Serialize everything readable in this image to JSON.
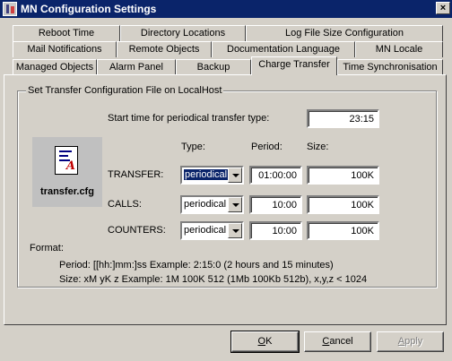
{
  "window": {
    "title": "MN Configuration Settings",
    "close": "×"
  },
  "tabs": {
    "row1": [
      "Reboot Time",
      "Directory Locations",
      "Log File Size Configuration"
    ],
    "row2": [
      "Mail Notifications",
      "Remote Objects",
      "Documentation Language",
      "MN Locale"
    ],
    "row3": [
      "Managed Objects",
      "Alarm Panel",
      "Backup",
      "Charge Transfer",
      "Time Synchronisation"
    ],
    "active": "Charge Transfer"
  },
  "group": {
    "title": "Set Transfer Configuration File on LocalHost",
    "start_time_label": "Start time for periodical transfer type:",
    "start_time_value": "23:15",
    "columns": {
      "type": "Type:",
      "period": "Period:",
      "size": "Size:"
    },
    "rows": [
      {
        "label": "TRANSFER:",
        "type": "periodical",
        "period": "01:00:00",
        "size": "100K"
      },
      {
        "label": "CALLS:",
        "type": "periodical",
        "period": "10:00",
        "size": "100K"
      },
      {
        "label": "COUNTERS:",
        "type": "periodical",
        "period": "10:00",
        "size": "100K"
      }
    ],
    "file_name": "transfer.cfg",
    "format_label": "Format:",
    "format_period": "Period: [[hh:]mm:]ss Example: 2:15:0 (2 hours and 15 minutes)",
    "format_size": "Size: xM yK z Example: 1M 100K 512 (1Mb 100Kb 512b), x,y,z < 1024"
  },
  "buttons": {
    "ok": {
      "mnemonic": "O",
      "rest": "K"
    },
    "cancel": {
      "mnemonic": "C",
      "rest": "ancel"
    },
    "apply": {
      "mnemonic": "A",
      "rest": "pply"
    }
  },
  "colors": {
    "face": "#d4d0c8",
    "title_bar": "#0a246a",
    "highlight": "#0a246a"
  }
}
